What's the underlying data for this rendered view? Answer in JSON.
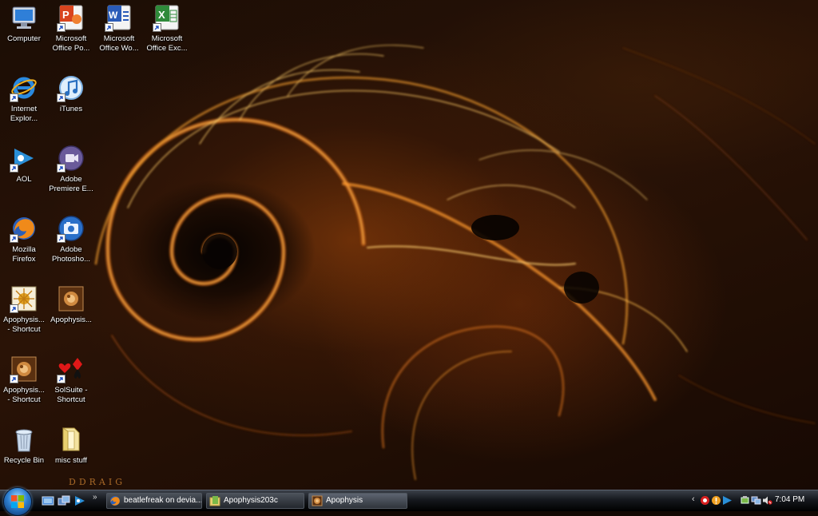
{
  "desktop": {
    "watermark": "DDRAIG",
    "icons": [
      {
        "label": "Computer",
        "icon": "computer-icon"
      },
      {
        "label": "Microsoft\nOffice Po...",
        "icon": "powerpoint-icon"
      },
      {
        "label": "Microsoft\nOffice Wo...",
        "icon": "word-icon"
      },
      {
        "label": "Microsoft\nOffice Exc...",
        "icon": "excel-icon"
      },
      {
        "label": "Internet\nExplor...",
        "icon": "internet-explorer-icon"
      },
      {
        "label": "iTunes",
        "icon": "itunes-icon"
      },
      {
        "label": "AOL",
        "icon": "aol-icon"
      },
      {
        "label": "Adobe\nPremiere E...",
        "icon": "premiere-icon"
      },
      {
        "label": "Mozilla\nFirefox",
        "icon": "firefox-icon"
      },
      {
        "label": "Adobe\nPhotosho...",
        "icon": "photoshop-icon"
      },
      {
        "label": "Apophysis...\n- Shortcut",
        "icon": "apophysis-icon"
      },
      {
        "label": "Apophysis...",
        "icon": "apophysis-flame-icon"
      },
      {
        "label": "Apophysis...\n- Shortcut",
        "icon": "apophysis-flame-icon"
      },
      {
        "label": "SolSuite -\nShortcut",
        "icon": "solsuite-icon"
      },
      {
        "label": "Recycle Bin",
        "icon": "recycle-bin-icon"
      },
      {
        "label": "misc stuff",
        "icon": "folder-icon"
      }
    ]
  },
  "taskbar": {
    "quick_launch_more": "»",
    "tasks": [
      {
        "label": "beatlefreak on devia...",
        "icon": "firefox-icon"
      },
      {
        "label": "Apophysis203c",
        "icon": "apophysis-folder-icon"
      },
      {
        "label": "Apophysis",
        "icon": "apophysis-flame-icon"
      }
    ],
    "tray_chevron": "‹",
    "clock": "7:04 PM"
  },
  "colors": {
    "taskbar": "#15181d",
    "accent": "#2d7fd0",
    "wallpaper_fire": "#e08a1a"
  }
}
